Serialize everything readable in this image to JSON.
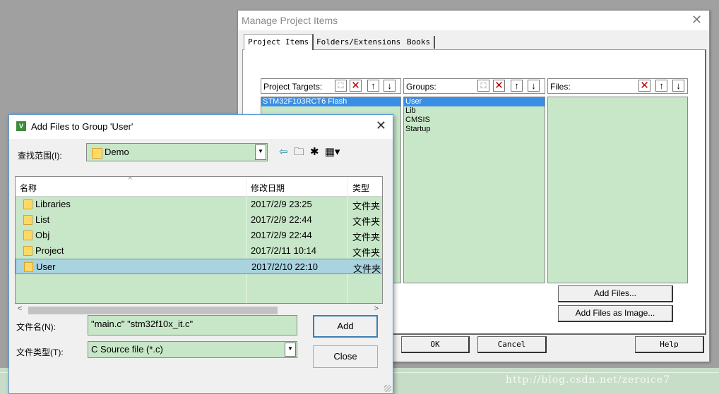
{
  "manage_dialog": {
    "title": "Manage Project Items",
    "tabs": [
      {
        "label": "Project Items",
        "active": true
      },
      {
        "label": "Folders/Extensions",
        "active": false
      },
      {
        "label": "Books",
        "active": false
      }
    ],
    "targets": {
      "label": "Project Targets:",
      "items": [
        "STM32F103RCT6 Flash"
      ],
      "selected": 0
    },
    "groups": {
      "label": "Groups:",
      "items": [
        "User",
        "Lib",
        "CMSIS",
        "Startup"
      ],
      "selected": 0
    },
    "files": {
      "label": "Files:",
      "items": []
    },
    "add_files_label": "Add Files...",
    "add_files_image_label": "Add Files as Image...",
    "ok_label": "OK",
    "cancel_label": "Cancel",
    "help_label": "Help"
  },
  "add_dialog": {
    "title": "Add Files to Group 'User'",
    "app_icon_text": "V",
    "look_in_label": "查找范围(I):",
    "look_in_value": "Demo",
    "columns": {
      "name": "名称",
      "date": "修改日期",
      "type": "类型"
    },
    "rows": [
      {
        "name": "Libraries",
        "date": "2017/2/9 23:25",
        "type": "文件夹",
        "selected": false
      },
      {
        "name": "List",
        "date": "2017/2/9 22:44",
        "type": "文件夹",
        "selected": false
      },
      {
        "name": "Obj",
        "date": "2017/2/9 22:44",
        "type": "文件夹",
        "selected": false
      },
      {
        "name": "Project",
        "date": "2017/2/11 10:14",
        "type": "文件夹",
        "selected": false
      },
      {
        "name": "User",
        "date": "2017/2/10 22:10",
        "type": "文件夹",
        "selected": true
      }
    ],
    "filename_label": "文件名(N):",
    "filename_value": "\"main.c\" \"stm32f10x_it.c\"",
    "filetype_label": "文件类型(T):",
    "filetype_value": "C Source file (*.c)",
    "add_label": "Add",
    "close_label": "Close"
  },
  "watermark": "http://blog.csdn.net/zeroice7",
  "colors": {
    "list_bg": "#c8e6c8",
    "selection": "#3a8ee6",
    "row_selection": "#a9d3df",
    "delete_red": "#c00000"
  }
}
